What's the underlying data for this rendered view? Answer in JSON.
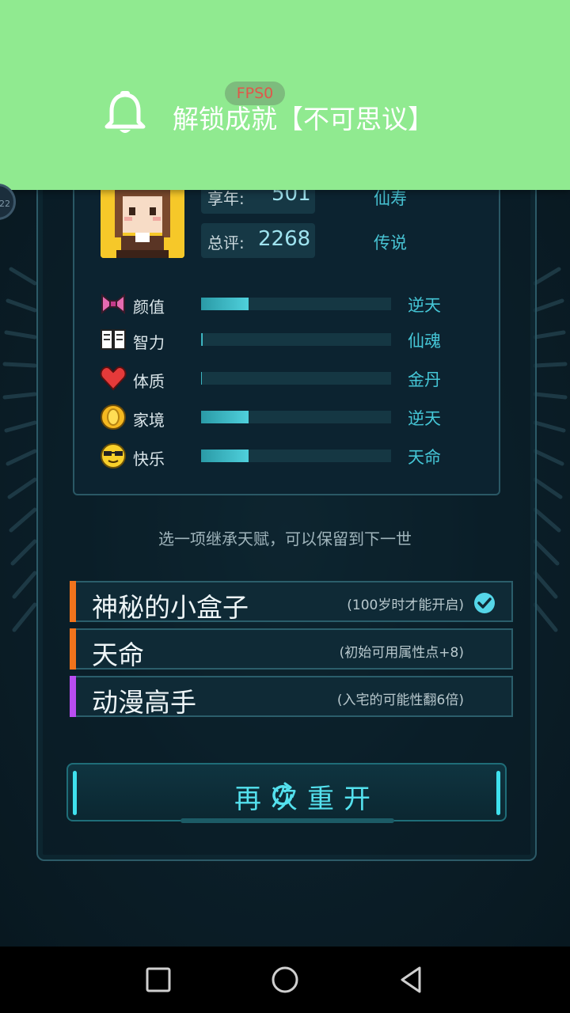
{
  "notification": {
    "text": "解锁成就【不可思议】",
    "fps_badge": "FPS0",
    "side_badge": "22",
    "bg_color": "#90ea90"
  },
  "profile": {
    "age_label": "享年:",
    "age_value": "501",
    "age_grade": "仙寿",
    "score_label": "总评:",
    "score_value": "2268",
    "score_grade": "传说"
  },
  "attributes": [
    {
      "icon": "bow-icon",
      "label": "颜值",
      "level": 0.25,
      "grade": "逆天"
    },
    {
      "icon": "book-icon",
      "label": "智力",
      "level": 0.01,
      "grade": "仙魂"
    },
    {
      "icon": "heart-icon",
      "label": "体质",
      "level": 0.0,
      "grade": "金丹"
    },
    {
      "icon": "coin-icon",
      "label": "家境",
      "level": 0.25,
      "grade": "逆天"
    },
    {
      "icon": "sunglasses-face-icon",
      "label": "快乐",
      "level": 0.25,
      "grade": "天命"
    }
  ],
  "hint": "选一项继承天赋，可以保留到下一世",
  "talents": [
    {
      "name": "神秘的小盒子",
      "desc": "(100岁时才能开启)",
      "color": "#f0731c",
      "selected": true
    },
    {
      "name": "天命",
      "desc": "(初始可用属性点+8)",
      "color": "#f0731c",
      "selected": false
    },
    {
      "name": "动漫高手",
      "desc": "(入宅的可能性翻6倍)",
      "color": "#b94df0",
      "selected": false
    }
  ],
  "restart_label": "再次重开",
  "colors": {
    "accent": "#45c6d6",
    "panel": "#0c2330"
  }
}
